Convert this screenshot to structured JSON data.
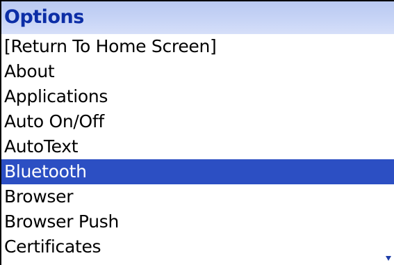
{
  "title": "Options",
  "menu": {
    "items": [
      {
        "label": "[Return To Home Screen]",
        "selected": false
      },
      {
        "label": "About",
        "selected": false
      },
      {
        "label": "Applications",
        "selected": false
      },
      {
        "label": "Auto On/Off",
        "selected": false
      },
      {
        "label": "AutoText",
        "selected": false
      },
      {
        "label": "Bluetooth",
        "selected": true
      },
      {
        "label": "Browser",
        "selected": false
      },
      {
        "label": "Browser Push",
        "selected": false
      },
      {
        "label": "Certificates",
        "selected": false
      }
    ]
  },
  "colors": {
    "title_text": "#0c2ea6",
    "title_bg": "#c7d4f6",
    "selection_bg": "#2c4fc3",
    "selection_text": "#ffffff"
  },
  "scroll_indicator_icon": "scroll-down-arrow-icon"
}
